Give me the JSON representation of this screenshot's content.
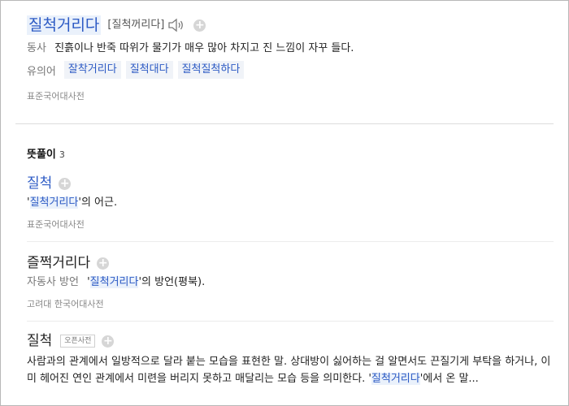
{
  "entry": {
    "headword": "질척거리다",
    "pronunciation": "[질척꺼리다]",
    "definition": {
      "pos": "동사",
      "text": "진흙이나 반죽 따위가 물기가 매우 많아 차지고 진 느낌이 자꾸 들다."
    },
    "synonyms": {
      "label": "유의어",
      "items": [
        "잘착거리다",
        "질척대다",
        "질척질척하다"
      ]
    },
    "source": "표준국어대사전"
  },
  "meanings": {
    "title": "뜻풀이",
    "count": "3",
    "items": [
      {
        "word": "질척",
        "quote_open": "'",
        "link": "질척거리다",
        "text_after": "'의 어근.",
        "source": "표준국어대사전"
      },
      {
        "word": "즐쩍거리다",
        "pos": "자동사 방언",
        "quote_open": "'",
        "link": "질척거리다",
        "text_after": "'의 방언(평북).",
        "source": "고려대 한국어대사전"
      },
      {
        "word": "질척",
        "badge": "오픈사전",
        "text_before": "사람과의 관계에서 일방적으로 달라 붙는 모습을 표현한 말. 상대방이 싫어하는 걸 알면서도 끈질기게 부탁을 하거나, 이미 헤어진 연인 관계에서 미련을 버리지 못하고 매달리는 모습 등을 의미한다. '",
        "link": "질척거리다",
        "text_after": "'에서 온 말..."
      }
    ]
  },
  "icons": {
    "speaker": "speaker-icon",
    "add": "plus-circle-icon"
  },
  "colors": {
    "link": "#2c5ac4",
    "highlight_bg": "#eaf1fb",
    "chip_bg": "#f0f3f8",
    "muted": "#888888"
  }
}
